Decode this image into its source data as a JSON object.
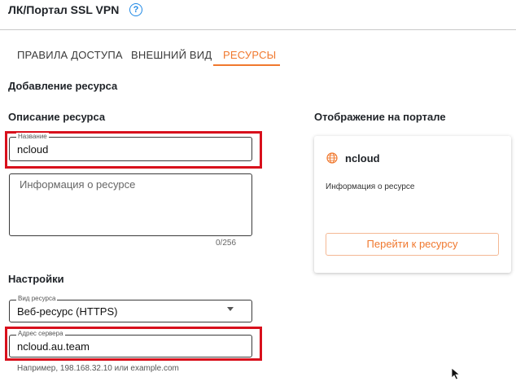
{
  "header": {
    "title": "ЛК/Портал SSL VPN",
    "help_icon": "help-circle-icon"
  },
  "tabs": [
    {
      "label": "ПРАВИЛА ДОСТУПА",
      "active": false
    },
    {
      "label": "ВНЕШНИЙ ВИД",
      "active": false
    },
    {
      "label": "РЕСУРСЫ",
      "active": true
    }
  ],
  "page": {
    "heading": "Добавление ресурса"
  },
  "description": {
    "heading": "Описание ресурса",
    "name_legend": "Название",
    "name_value": "ncloud",
    "info_placeholder": "Информация о ресурсе",
    "info_counter": "0/256"
  },
  "preview": {
    "heading": "Отображение на портале",
    "card_title": "ncloud",
    "card_description": "Информация о ресурсе",
    "card_button": "Перейти к ресурсу",
    "icon": "globe-icon"
  },
  "settings": {
    "heading": "Настройки",
    "type_legend": "Вид ресурса",
    "type_value": "Веб-ресурс (HTTPS)",
    "address_legend": "Адрес сервера",
    "address_value": "ncloud.au.team",
    "address_hint": "Например, 198.168.32.10 или example.com"
  },
  "colors": {
    "accent": "#f0782e",
    "highlight": "#d8101c",
    "help": "#1e88e5"
  }
}
